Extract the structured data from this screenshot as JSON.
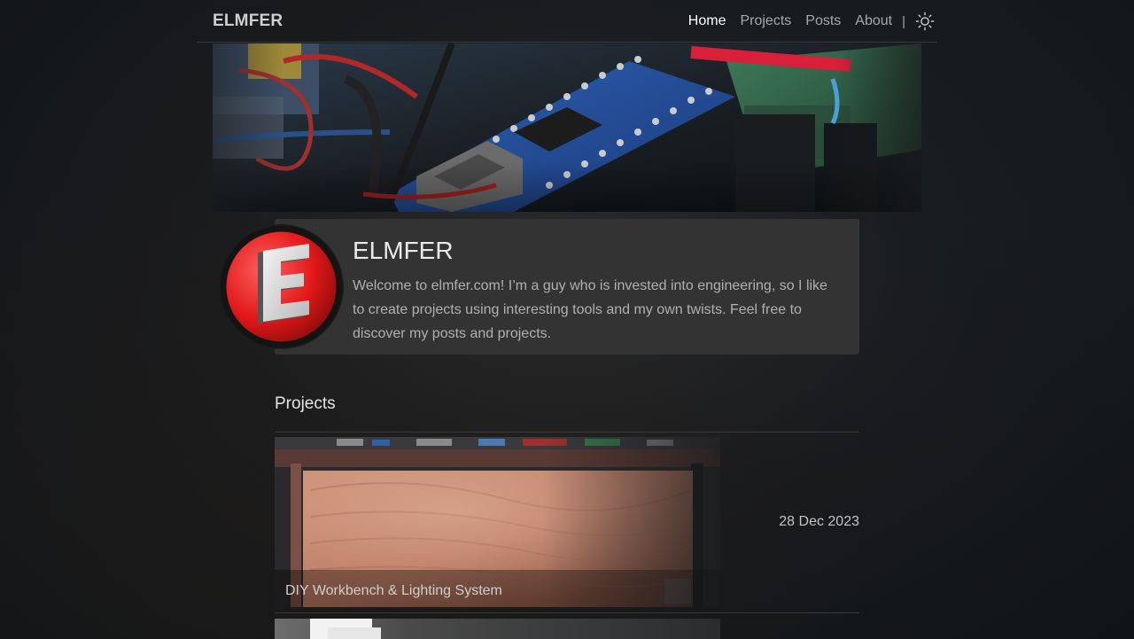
{
  "navbar": {
    "brand": "ELMFER",
    "links": [
      {
        "label": "Home",
        "active": true
      },
      {
        "label": "Projects",
        "active": false
      },
      {
        "label": "Posts",
        "active": false
      },
      {
        "label": "About",
        "active": false
      }
    ],
    "separator": "|",
    "theme_icon": "sun-icon"
  },
  "profile": {
    "name": "ELMFER",
    "description": "Welcome to elmfer.com! I’m a guy who is invested into engineering, so I like to create projects using interesting tools and my own twists. Feel free to discover my posts and projects.",
    "avatar_icon": "letter-e-logo"
  },
  "projects": {
    "heading": "Projects",
    "items": [
      {
        "title": "DIY Workbench & Lighting System",
        "date": "28 Dec 2023"
      }
    ]
  },
  "colors": {
    "background": "#1a1b1d",
    "card": "#333333",
    "accent_red": "#e02020",
    "active_link": "#ffffff",
    "muted_text": "#a9a9a9"
  }
}
